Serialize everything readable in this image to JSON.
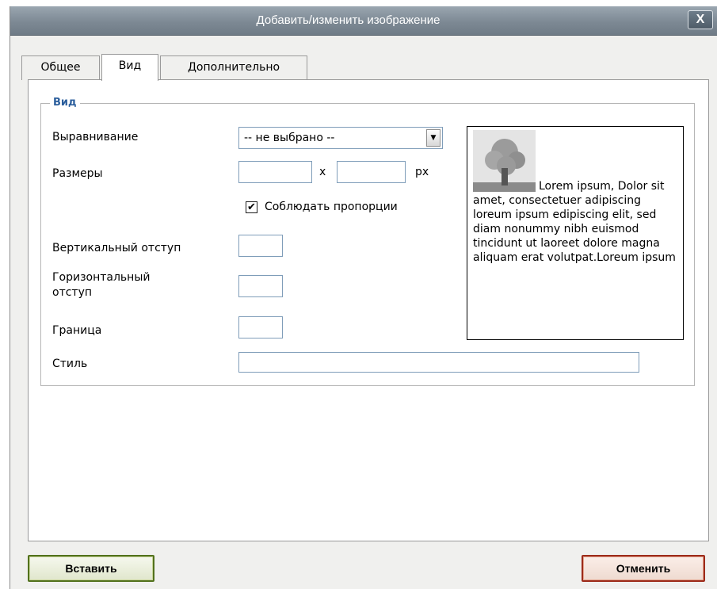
{
  "dialog": {
    "title": "Добавить/изменить изображение",
    "close_label": "X"
  },
  "tabs": [
    {
      "label": "Общее",
      "active": false
    },
    {
      "label": "Вид",
      "active": true
    },
    {
      "label": "Дополнительно",
      "active": false
    }
  ],
  "appearance": {
    "legend": "Вид",
    "align": {
      "label": "Выравнивание",
      "value": "-- не выбрано --"
    },
    "dimensions": {
      "label": "Размеры",
      "width": "",
      "height": "",
      "separator": "x",
      "unit": "px"
    },
    "constrain": {
      "label": "Соблюдать пропорции",
      "checked": true
    },
    "vspace": {
      "label": "Вертикальный отступ",
      "value": ""
    },
    "hspace": {
      "label_line1": "Горизонтальный",
      "label_line2": "отступ",
      "value": ""
    },
    "border": {
      "label": "Граница",
      "value": ""
    },
    "style": {
      "label": "Стиль",
      "value": ""
    },
    "preview_text": "Lorem ipsum, Dolor sit amet, consectetuer adipiscing loreum ipsum edipiscing elit, sed diam nonummy nibh euismod tincidunt ut laoreet dolore magna aliquam erat volutpat.Loreum ipsum"
  },
  "buttons": {
    "insert": "Вставить",
    "cancel": "Отменить"
  },
  "colors": {
    "legend": "#2b5e9c",
    "insert_border": "#52711c",
    "cancel_border": "#9c2b1a"
  }
}
